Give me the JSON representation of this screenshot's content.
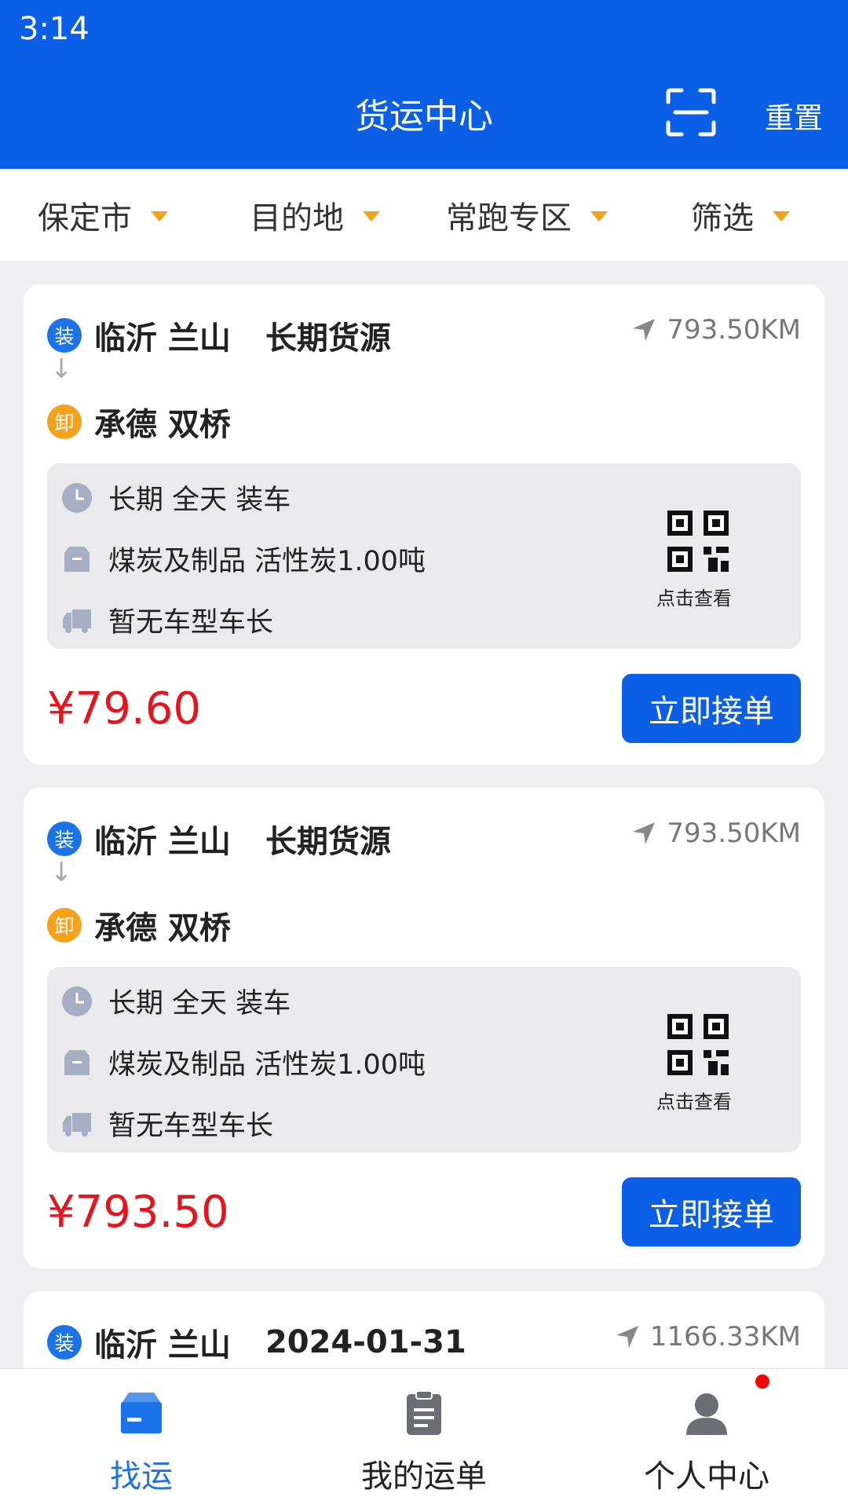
{
  "status_bar": {
    "time": "3:14"
  },
  "header": {
    "title": "货运中心",
    "scan_icon": "scan-icon",
    "reset_label": "重置"
  },
  "filters": [
    {
      "label": "保定市"
    },
    {
      "label": "目的地"
    },
    {
      "label": "常跑专区"
    },
    {
      "label": "筛选"
    }
  ],
  "orders": [
    {
      "load_badge": "装",
      "unload_badge": "卸",
      "origin": "临沂 兰山",
      "tag": "长期货源",
      "destination": "承德 双桥",
      "distance": "793.50KM",
      "time_info": "长期  全天 装车",
      "cargo_info": "煤炭及制品  活性炭1.00吨",
      "truck_info": "暂无车型车长",
      "qr_label": "点击查看",
      "price": "¥79.60",
      "accept_label": "立即接单"
    },
    {
      "load_badge": "装",
      "unload_badge": "卸",
      "origin": "临沂 兰山",
      "tag": "长期货源",
      "destination": "承德 双桥",
      "distance": "793.50KM",
      "time_info": "长期  全天 装车",
      "cargo_info": "煤炭及制品  活性炭1.00吨",
      "truck_info": "暂无车型车长",
      "qr_label": "点击查看",
      "price": "¥793.50",
      "accept_label": "立即接单"
    },
    {
      "load_badge": "装",
      "origin": "临沂 兰山",
      "tag": "2024-01-31",
      "distance": "1166.33KM"
    }
  ],
  "tabs": [
    {
      "label": "找运",
      "icon": "box-icon",
      "active": true
    },
    {
      "label": "我的运单",
      "icon": "clipboard-icon",
      "active": false
    },
    {
      "label": "个人中心",
      "icon": "person-icon",
      "active": false
    }
  ],
  "colors": {
    "primary": "#0a5fe6",
    "price": "#e8141c",
    "accent": "#f5a11a",
    "badge_notification": "#ff0000"
  }
}
